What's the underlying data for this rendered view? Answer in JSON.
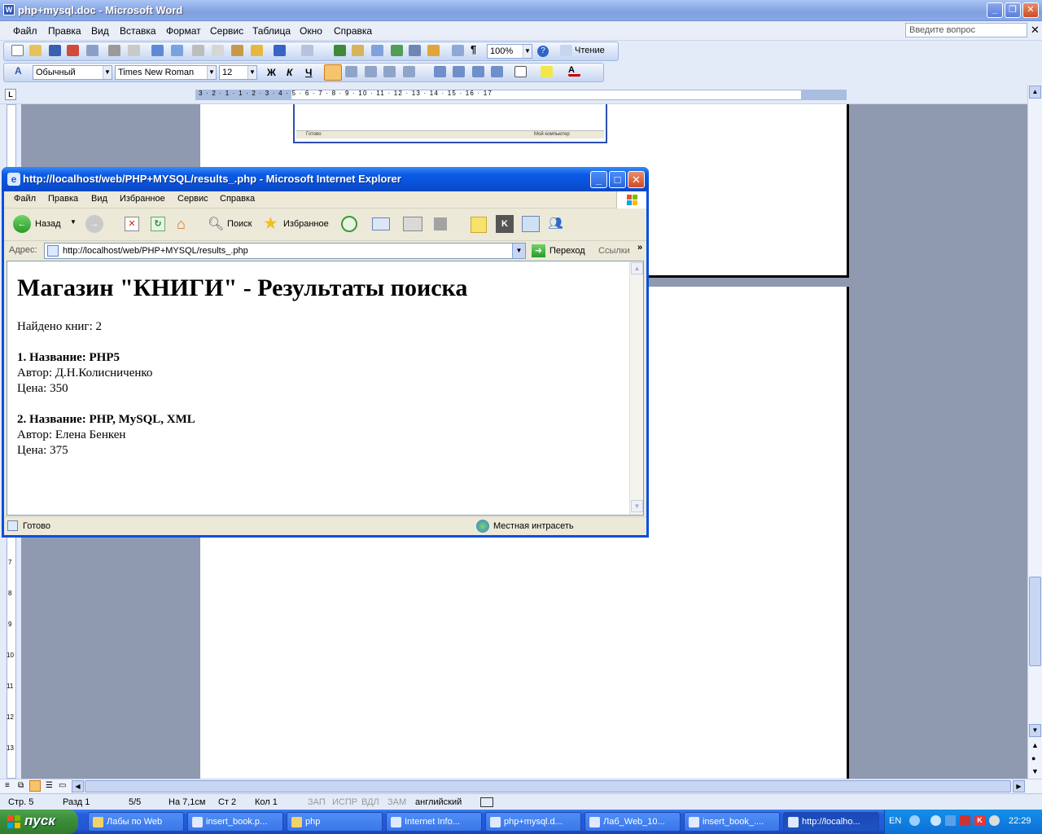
{
  "word": {
    "title": "php+mysql.doc - Microsoft Word",
    "menu": [
      "Файл",
      "Правка",
      "Вид",
      "Вставка",
      "Формат",
      "Сервис",
      "Таблица",
      "Окно",
      "Справка"
    ],
    "ask_placeholder": "Введите вопрос",
    "zoom": "100%",
    "reading_label": "Чтение",
    "style": "Обычный",
    "font": "Times New Roman",
    "font_size": "12",
    "bold": "Ж",
    "italic": "К",
    "underline": "Ч",
    "ruler_numbers": "3 · 2 · 1 · 1 · 2 · 3 · 4 · 5 · 6 · 7 · 8 · 9 · 10 · 11 · 12 · 13 · 14 · 15 · 16 · 17",
    "embedded_status_left": "Готово",
    "embedded_status_right": "Мой компьютер",
    "status": {
      "page": "Стр. 5",
      "section": "Разд 1",
      "pages": "5/5",
      "at": "На 7,1см",
      "line": "Ст 2",
      "col": "Кол 1",
      "rec": "ЗАП",
      "trk": "ИСПР",
      "ext": "ВДЛ",
      "ovr": "ЗАМ",
      "lang": "английский"
    },
    "vruler_numbers": [
      "7",
      "8",
      "9",
      "10",
      "11",
      "12",
      "13"
    ]
  },
  "ie": {
    "title": "http://localhost/web/PHP+MYSQL/results_.php - Microsoft Internet Explorer",
    "menu": [
      "Файл",
      "Правка",
      "Вид",
      "Избранное",
      "Сервис",
      "Справка"
    ],
    "back_label": "Назад",
    "search_label": "Поиск",
    "favorites_label": "Избранное",
    "address_label": "Адрес:",
    "address": "http://localhost/web/PHP+MYSQL/results_.php",
    "go_label": "Переход",
    "links_label": "Ссылки",
    "status_left": "Готово",
    "status_right": "Местная интрасеть"
  },
  "page": {
    "heading": "Магазин \"КНИГИ\" - Результаты поиска",
    "found": "Найдено книг: 2",
    "books": [
      {
        "title": "1. Название: PHP5",
        "author": "Автор: Д.Н.Колисниченко",
        "price": "Цена: 350"
      },
      {
        "title": "2. Название: PHP, MySQL, XML",
        "author": "Автор: Елена Бенкен",
        "price": "Цена: 375"
      }
    ]
  },
  "taskbar": {
    "start": "пуск",
    "tasks": [
      "Лабы по Web",
      "insert_book.p...",
      "php",
      "Internet Info...",
      "php+mysql.d...",
      "Лаб_Web_10...",
      "insert_book_....",
      "http://localho..."
    ],
    "lang": "EN",
    "clock": "22:29"
  }
}
